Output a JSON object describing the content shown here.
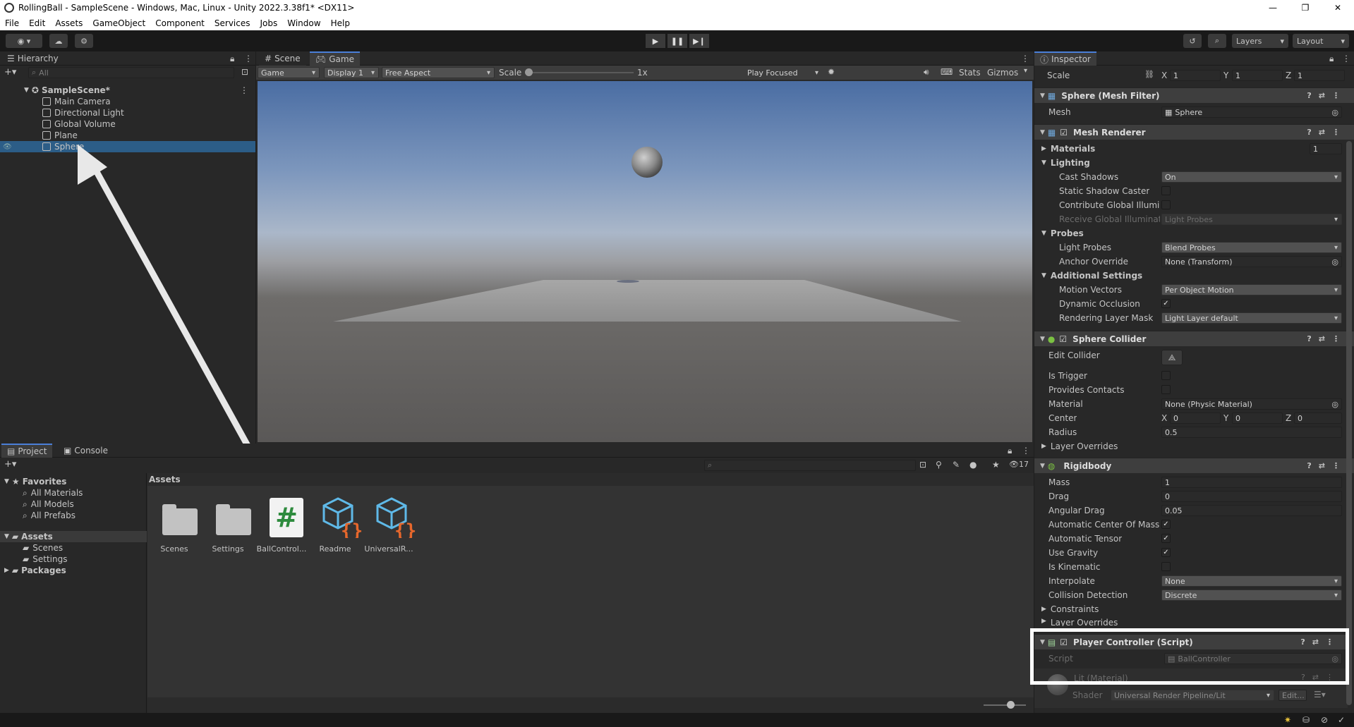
{
  "window": {
    "title": "RollingBall - SampleScene - Windows, Mac, Linux - Unity 2022.3.38f1* <DX11>",
    "controls": [
      "—",
      "❐",
      "✕"
    ]
  },
  "menu": [
    "File",
    "Edit",
    "Assets",
    "GameObject",
    "Component",
    "Services",
    "Jobs",
    "Window",
    "Help"
  ],
  "toolbar": {
    "layers_label": "Layers",
    "layout_label": "Layout"
  },
  "hierarchy": {
    "tab": "Hierarchy",
    "search_placeholder": "All",
    "scene": "SampleScene*",
    "items": [
      "Main Camera",
      "Directional Light",
      "Global Volume",
      "Plane",
      "Sphere"
    ]
  },
  "game_view": {
    "tabs": [
      "Scene",
      "Game"
    ],
    "game_dropdown": "Game",
    "display": "Display 1",
    "aspect": "Free Aspect",
    "scale_label": "Scale",
    "scale_value": "1x",
    "play_focused": "Play Focused",
    "stats": "Stats",
    "gizmos": "Gizmos"
  },
  "project": {
    "tabs": [
      "Project",
      "Console"
    ],
    "favorites_label": "Favorites",
    "favorites": [
      "All Materials",
      "All Models",
      "All Prefabs"
    ],
    "assets_label": "Assets",
    "asset_folders": [
      "Scenes",
      "Settings"
    ],
    "packages_label": "Packages",
    "breadcrumb": "Assets",
    "hidden_count": "17",
    "assets": [
      {
        "name": "Scenes",
        "icon": "folder-icon"
      },
      {
        "name": "Settings",
        "icon": "folder-icon"
      },
      {
        "name": "BallControl...",
        "icon": "csharp-script-icon"
      },
      {
        "name": "Readme",
        "icon": "scriptable-object-icon"
      },
      {
        "name": "UniversalR...",
        "icon": "scriptable-object-icon"
      }
    ]
  },
  "inspector": {
    "tab": "Inspector",
    "transform_scale": {
      "label": "Scale",
      "x": "1",
      "y": "1",
      "z": "1"
    },
    "mesh_filter": {
      "title": "Sphere (Mesh Filter)",
      "mesh_label": "Mesh",
      "mesh_value": "Sphere"
    },
    "mesh_renderer": {
      "title": "Mesh Renderer",
      "materials_label": "Materials",
      "materials_count": "1",
      "lighting_label": "Lighting",
      "cast_shadows_label": "Cast Shadows",
      "cast_shadows_value": "On",
      "static_shadow_label": "Static Shadow Caster",
      "contribute_gi_label": "Contribute Global Illumina",
      "receive_gi_label": "Receive Global Illuminati",
      "receive_gi_value": "Light Probes",
      "probes_label": "Probes",
      "light_probes_label": "Light Probes",
      "light_probes_value": "Blend Probes",
      "anchor_label": "Anchor Override",
      "anchor_value": "None (Transform)",
      "additional_label": "Additional Settings",
      "motion_label": "Motion Vectors",
      "motion_value": "Per Object Motion",
      "dynamic_occlusion_label": "Dynamic Occlusion",
      "rendering_layer_label": "Rendering Layer Mask",
      "rendering_layer_value": "Light Layer default"
    },
    "sphere_collider": {
      "title": "Sphere Collider",
      "edit_label": "Edit Collider",
      "trigger_label": "Is Trigger",
      "provides_label": "Provides Contacts",
      "material_label": "Material",
      "material_value": "None (Physic Material)",
      "center_label": "Center",
      "center": {
        "x": "0",
        "y": "0",
        "z": "0"
      },
      "radius_label": "Radius",
      "radius_value": "0.5",
      "layer_overrides": "Layer Overrides"
    },
    "rigidbody": {
      "title": "Rigidbody",
      "mass_label": "Mass",
      "mass": "1",
      "drag_label": "Drag",
      "drag": "0",
      "angular_label": "Angular Drag",
      "angular": "0.05",
      "auto_center_label": "Automatic Center Of Mass",
      "auto_tensor_label": "Automatic Tensor",
      "gravity_label": "Use Gravity",
      "kinematic_label": "Is Kinematic",
      "interpolate_label": "Interpolate",
      "interpolate": "None",
      "collision_label": "Collision Detection",
      "collision": "Discrete",
      "constraints_label": "Constraints",
      "layer_overrides": "Layer Overrides"
    },
    "player_controller": {
      "title": "Player Controller (Script)",
      "script_label": "Script",
      "script_value": "BallController"
    },
    "material": {
      "title": "Lit (Material)",
      "shader_label": "Shader",
      "shader_value": "Universal Render Pipeline/Lit",
      "edit_label": "Edit..."
    }
  },
  "colors": {
    "selection": "#2c5d87",
    "accent": "#4a7fd8",
    "highlight_box": "#ffffff"
  }
}
